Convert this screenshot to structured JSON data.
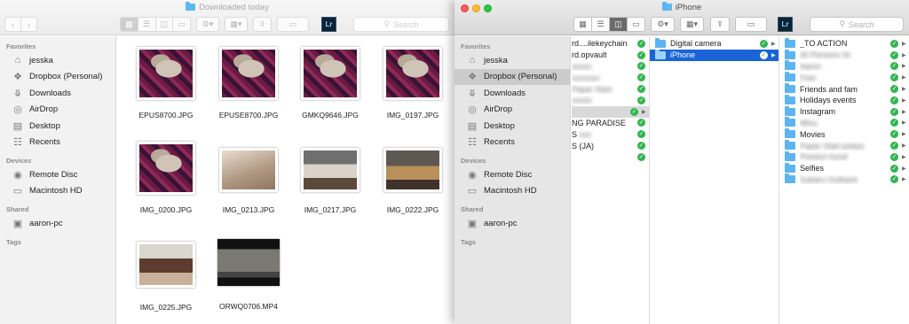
{
  "window1": {
    "title": "Downloaded today",
    "search_placeholder": "Search",
    "lr_label": "Lr",
    "sidebar": {
      "favorites_header": "Favorites",
      "favorites": [
        "jesska",
        "Dropbox (Personal)",
        "Downloads",
        "AirDrop",
        "Desktop",
        "Recents"
      ],
      "devices_header": "Devices",
      "devices": [
        "Remote Disc",
        "Macintosh HD"
      ],
      "shared_header": "Shared",
      "shared": [
        "aaron-pc"
      ],
      "tags_header": "Tags"
    },
    "files": [
      "EPUS8700.JPG",
      "EPUSE8700.JPG",
      "GMKQ9646.JPG",
      "IMG_0197.JPG",
      "IMG_0200.JPG",
      "IMG_0213.JPG",
      "IMG_0217.JPG",
      "IMG_0222.JPG",
      "IMG_0225.JPG",
      "ORWQ0706.MP4"
    ]
  },
  "window2": {
    "title": "iPhone",
    "search_placeholder": "Search",
    "lr_label": "Lr",
    "sidebar": {
      "favorites_header": "Favorites",
      "favorites": [
        "jesska",
        "Dropbox (Personal)",
        "Downloads",
        "AirDrop",
        "Desktop",
        "Recents"
      ],
      "devices_header": "Devices",
      "devices": [
        "Remote Disc",
        "Macintosh HD"
      ],
      "shared_header": "Shared",
      "shared": [
        "aaron-pc"
      ],
      "tags_header": "Tags"
    },
    "column1": [
      "rd....ilekeychain",
      "rd.opvault",
      "",
      "",
      "",
      "",
      "",
      "NG PARADISE",
      "S",
      "S (JA)",
      ""
    ],
    "column2": [
      "Digital camera",
      "iPhone"
    ],
    "column3": [
      "_TO ACTION",
      "",
      "",
      "",
      "Friends and fam",
      "Holidays events",
      "Instagram",
      "",
      "Movies",
      "",
      "",
      "Selfies",
      ""
    ]
  }
}
